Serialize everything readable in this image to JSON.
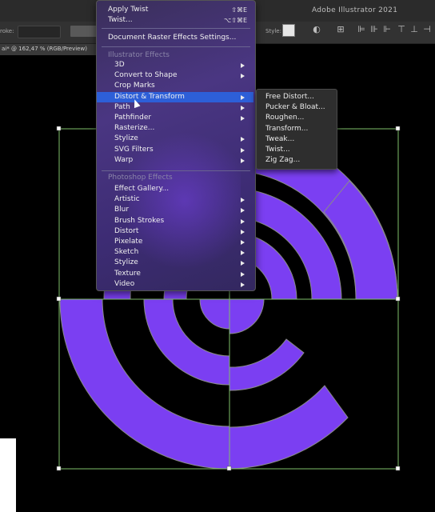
{
  "app": {
    "title": "Adobe Illustrator 2021"
  },
  "control_bar": {
    "stroke_label": "roke:",
    "style_label": "Style:"
  },
  "document_tab": {
    "label": "ai* @ 162,47 % (RGB/Preview)"
  },
  "effect_menu": {
    "apply_twist": {
      "label": "Apply Twist",
      "shortcut": "⇧⌘E"
    },
    "twist": {
      "label": "Twist...",
      "shortcut": "⌥⇧⌘E"
    },
    "document_raster": "Document Raster Effects Settings...",
    "illustrator_header": "Illustrator Effects",
    "illustrator_items": [
      {
        "label": "3D",
        "submenu": true
      },
      {
        "label": "Convert to Shape",
        "submenu": true
      },
      {
        "label": "Crop Marks",
        "submenu": false
      },
      {
        "label": "Distort & Transform",
        "submenu": true,
        "highlighted": true
      },
      {
        "label": "Path",
        "submenu": true
      },
      {
        "label": "Pathfinder",
        "submenu": true
      },
      {
        "label": "Rasterize...",
        "submenu": false
      },
      {
        "label": "Stylize",
        "submenu": true
      },
      {
        "label": "SVG Filters",
        "submenu": true
      },
      {
        "label": "Warp",
        "submenu": true
      }
    ],
    "photoshop_header": "Photoshop Effects",
    "photoshop_items": [
      {
        "label": "Effect Gallery...",
        "submenu": false
      },
      {
        "label": "Artistic",
        "submenu": true
      },
      {
        "label": "Blur",
        "submenu": true
      },
      {
        "label": "Brush Strokes",
        "submenu": true
      },
      {
        "label": "Distort",
        "submenu": true
      },
      {
        "label": "Pixelate",
        "submenu": true
      },
      {
        "label": "Sketch",
        "submenu": true
      },
      {
        "label": "Stylize",
        "submenu": true
      },
      {
        "label": "Texture",
        "submenu": true
      },
      {
        "label": "Video",
        "submenu": true
      }
    ]
  },
  "distort_submenu": {
    "items": [
      "Free Distort...",
      "Pucker & Bloat...",
      "Roughen...",
      "Transform...",
      "Tweak...",
      "Twist...",
      "Zig Zag..."
    ]
  },
  "colors": {
    "shape_fill": "#7b3ff2",
    "menu_highlight": "#2d5fd8",
    "selection_box": "#7fbf6a"
  }
}
